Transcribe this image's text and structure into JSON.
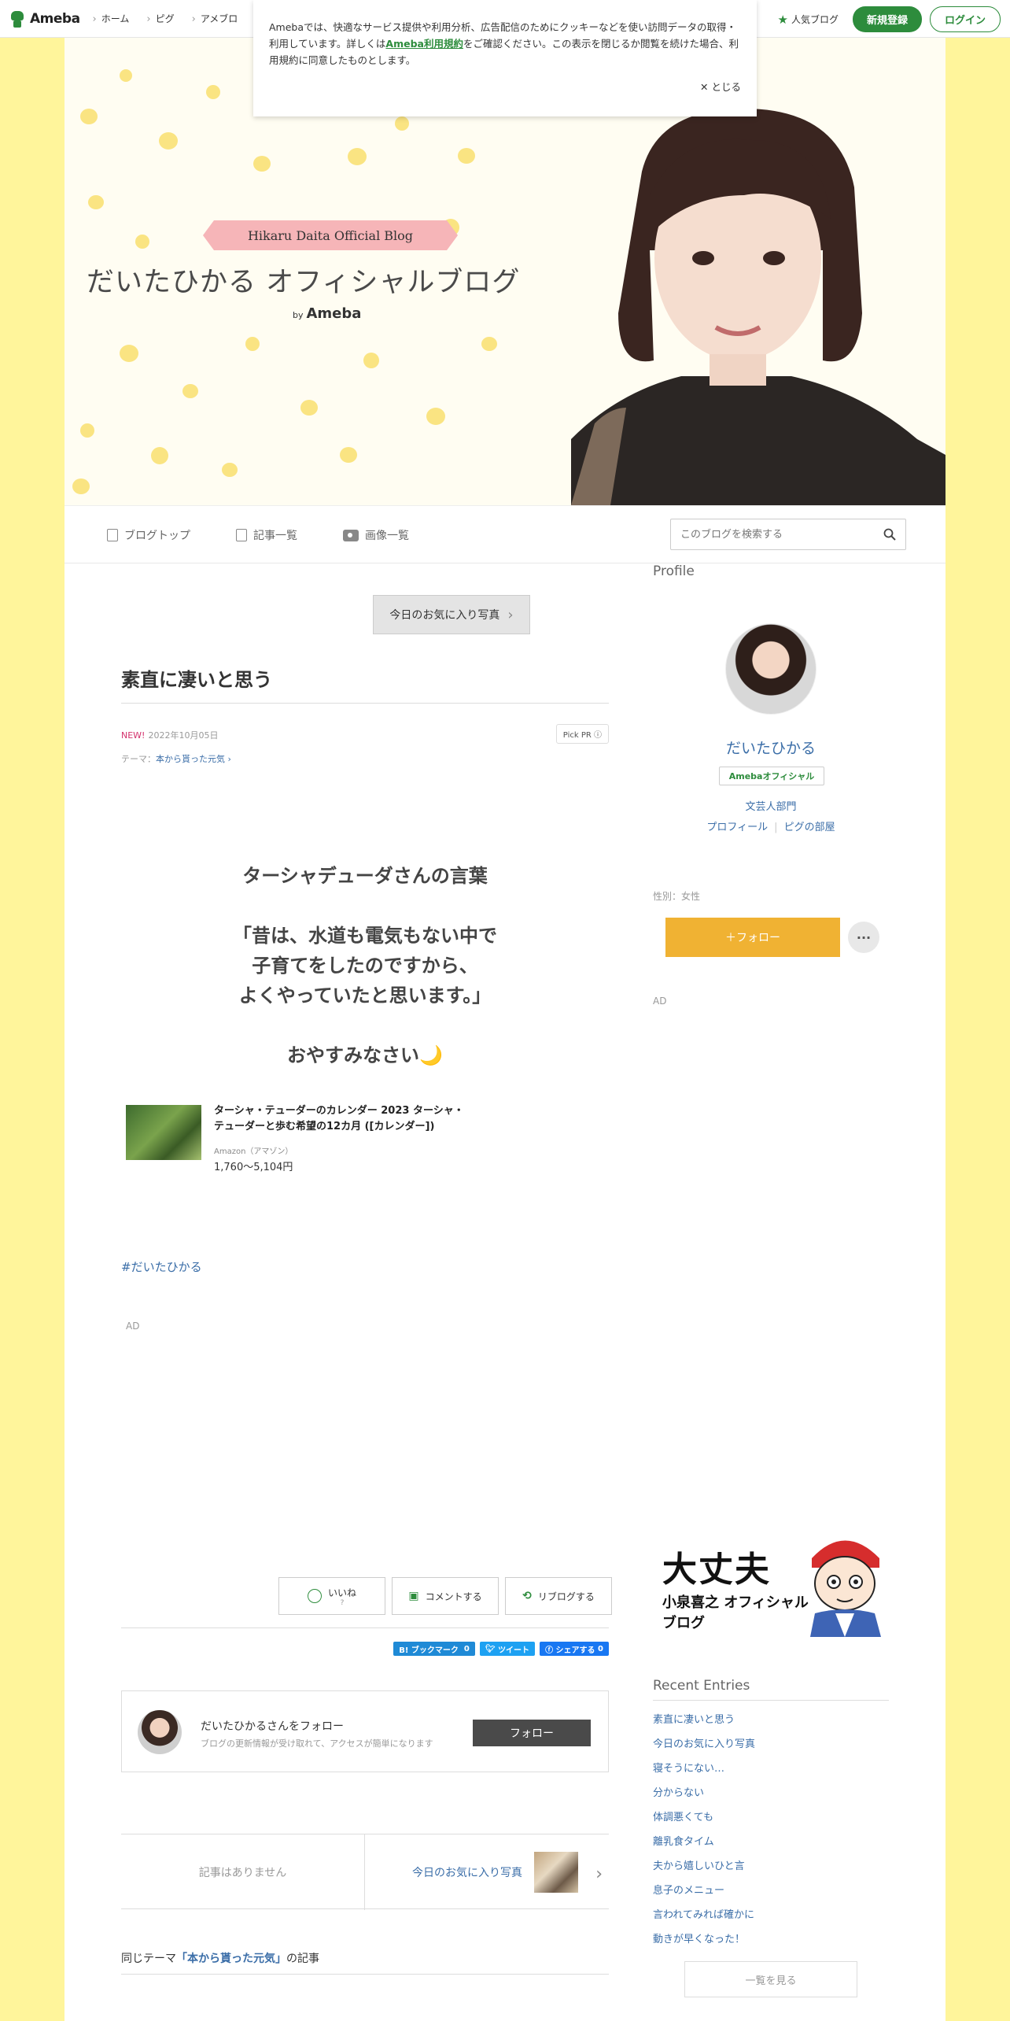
{
  "topbar": {
    "logo": "Ameba",
    "nav": [
      "ホーム",
      "ピグ",
      "アメブロ"
    ],
    "popular": "人気ブログ",
    "register": "新規登録",
    "login": "ログイン"
  },
  "cookie": {
    "text1": "Amebaでは、快適なサービス提供や利用分析、広告配信のためにクッキーなどを使い訪問データの取得・利用しています。詳しくは",
    "link": "Ameba利用規約",
    "text2": "をご確認ください。この表示を閉じるか閲覧を続けた場合、利用規約に同意したものとします。",
    "close": "とじる"
  },
  "header": {
    "ribbon": "Hikaru Daita Official Blog",
    "title": "だいたひかる オフィシャルブログ",
    "by": "by",
    "ameba": "Ameba"
  },
  "blognav": {
    "top": "ブログトップ",
    "list": "記事一覧",
    "images": "画像一覧",
    "search_placeholder": "このブログを検索する"
  },
  "post": {
    "fav_button": "今日のお気に入り写真",
    "title": "素直に凄いと思う",
    "new": "NEW!",
    "date": "2022年10月05日",
    "pickpr": "Pick PR",
    "theme_label": "テーマ：",
    "theme": "本から貰った元気",
    "lines": [
      "ターシャデューダさんの言葉",
      "",
      "「昔は、水道も電気もない中で",
      "子育てをしたのですから、",
      "よくやっていたと思います。」",
      "",
      "おやすみなさい🌙"
    ],
    "amazon_title": "ターシャ・テューダーのカレンダー 2023 ターシャ・テューダーと歩む希望の12カ月 ([カレンダー])",
    "amazon_source": "Amazon（アマゾン）",
    "amazon_price": "1,760〜5,104円",
    "hashtag": "#だいたひかる",
    "ad": "AD"
  },
  "actions": {
    "like": "いいね",
    "like_count": "?",
    "comment": "コメントする",
    "reblog": "リブログする",
    "hatena": "B! ブックマーク",
    "hatena_count": "0",
    "tweet": "ツイート",
    "fb_share": "シェアする",
    "fb_count": "0"
  },
  "follow": {
    "title": "だいたひかるさんをフォロー",
    "sub": "ブログの更新情報が受け取れて、アクセスが簡単になります",
    "button": "フォロー"
  },
  "pager": {
    "prev": "記事はありません",
    "next": "今日のお気に入り写真"
  },
  "same_theme": {
    "prefix": "同じテーマ",
    "theme": "「本から貰った元気」",
    "suffix": "の記事"
  },
  "sidebar": {
    "profile_heading": "Profile",
    "name": "だいたひかる",
    "badge": "Amebaオフィシャル",
    "category": "文芸人部門",
    "link_profile": "プロフィール",
    "link_pig": "ピグの部屋",
    "gender": "性別：女性",
    "follow": "＋フォロー",
    "more": "···",
    "ad": "AD",
    "banner_line1": "大丈夫",
    "banner_line2": "小泉喜之 オフィシャルブログ",
    "recent_heading": "Recent Entries",
    "recent": [
      "素直に凄いと思う",
      "今日のお気に入り写真",
      "寝そうにない…",
      "分からない",
      "体調悪くても",
      "離乳食タイム",
      "夫から嬉しいひと言",
      "息子のメニュー",
      "言われてみれば確かに",
      "動きが早くなった！"
    ],
    "see_all": "一覧を見る"
  },
  "colors": {
    "background": "#fff59b",
    "brand_green": "#2d8c3c",
    "link_blue": "#3b6ea8",
    "follow_orange": "#f0b233"
  }
}
